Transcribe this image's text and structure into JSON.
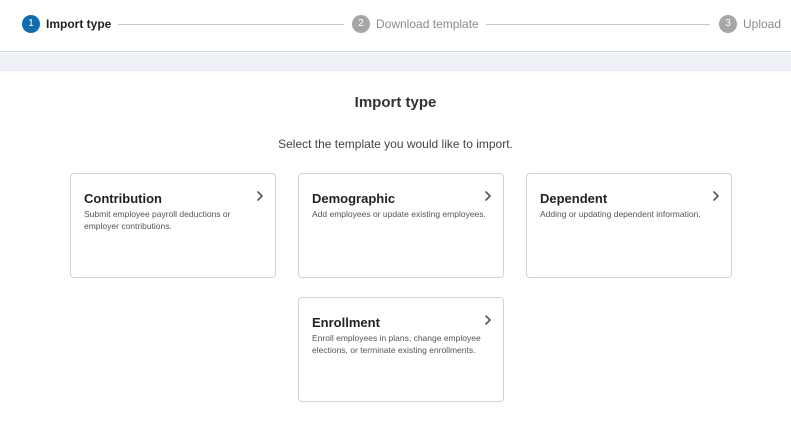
{
  "stepper": {
    "steps": [
      {
        "number": "1",
        "label": "Import type",
        "state": "active"
      },
      {
        "number": "2",
        "label": "Download template",
        "state": "inactive"
      },
      {
        "number": "3",
        "label": "Upload",
        "state": "inactive"
      }
    ]
  },
  "main": {
    "heading": "Import type",
    "subtitle": "Select the template you would like to import.",
    "cards": [
      {
        "title": "Contribution",
        "description": "Submit employee payroll deductions or employer contributions.",
        "icon": "chevron-right-icon"
      },
      {
        "title": "Demographic",
        "description": "Add employees or update existing employees.",
        "icon": "chevron-right-icon"
      },
      {
        "title": "Dependent",
        "description": "Adding or updating dependent information.",
        "icon": "chevron-right-icon"
      },
      {
        "title": "Enrollment",
        "description": "Enroll employees in plans, change employee elections, or terminate existing enrollments.",
        "icon": "chevron-right-icon"
      }
    ]
  },
  "colors": {
    "active_step": "#0e6cb0",
    "inactive_step": "#a6a6a6",
    "card_border": "#cfd4d9",
    "band": "#eef2f6"
  }
}
